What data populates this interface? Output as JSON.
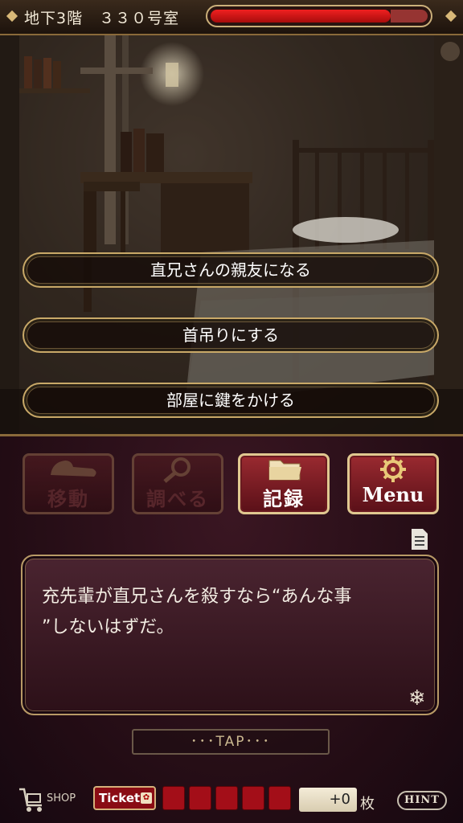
{
  "header": {
    "location": "地下3階　３３０号室",
    "hp_fraction": 0.83
  },
  "choices": [
    {
      "label": "直兄さんの親友になる"
    },
    {
      "label": "首吊りにする"
    },
    {
      "label": "部屋に鍵をかける"
    }
  ],
  "commands": {
    "move": {
      "label": "移動",
      "icon": "shoe-icon",
      "enabled": false
    },
    "examine": {
      "label": "調べる",
      "icon": "magnifier-icon",
      "enabled": false
    },
    "record": {
      "label": "記録",
      "icon": "folder-icon",
      "enabled": true
    },
    "menu": {
      "label": "Menu",
      "icon": "gear-icon",
      "enabled": true
    }
  },
  "message": {
    "line1": "充先輩が直兄さんを殺すなら“あんな事",
    "line2": "”しないはずだ。"
  },
  "tap_label": "･･･TAP･･･",
  "footer": {
    "shop_label": "SHOP",
    "ticket_label": "Ticket",
    "ticket_slots_filled": 5,
    "count": "+0",
    "unit": "枚",
    "hint_label": "HINT"
  },
  "colors": {
    "accent_gold": "#c9a968",
    "panel_crimson": "#3a1622",
    "hp_red": "#e01818"
  }
}
